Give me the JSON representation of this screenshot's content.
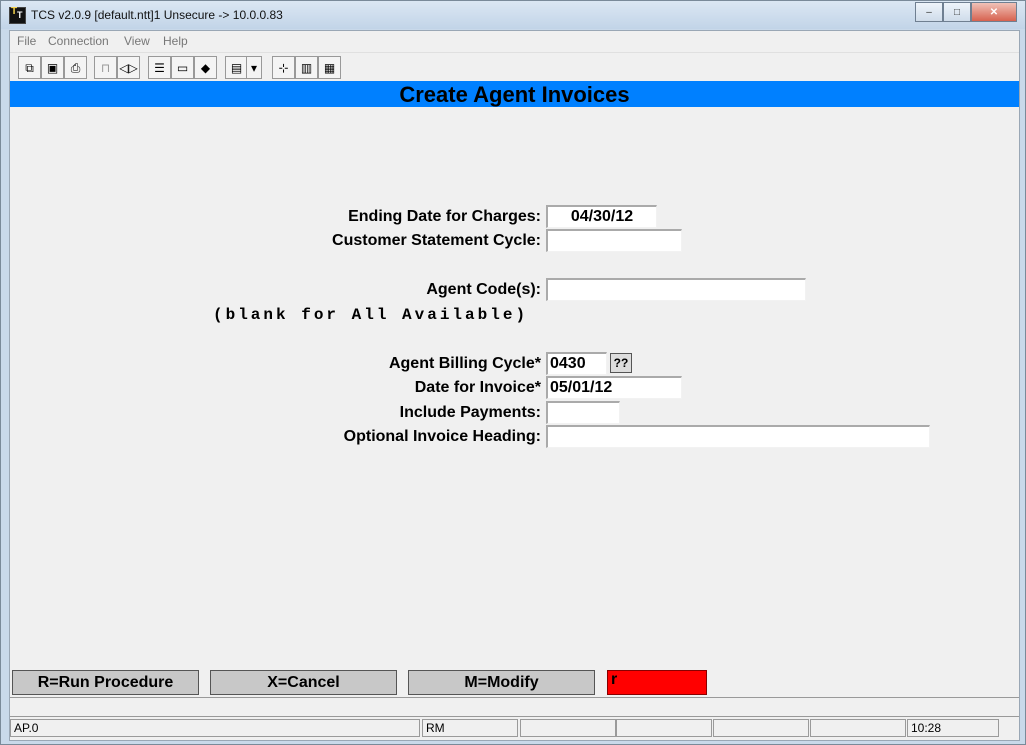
{
  "window": {
    "title": "TCS v2.0.9 [default.ntt]1 Unsecure -> 10.0.0.83",
    "controls": {
      "minimize": "–",
      "maximize": "□",
      "close": "✕"
    }
  },
  "menu": {
    "file": "File",
    "connection": "Connection",
    "view": "View",
    "help": "Help"
  },
  "toolbar": {
    "icons": [
      "copy-icon",
      "save-icon",
      "print-icon",
      "lock-icon",
      "sound-icon",
      "properties-icon",
      "monitor-icon",
      "eraser-icon",
      "document-icon",
      "dropdown-icon",
      "network-icon",
      "chart-icon",
      "calculator-icon"
    ]
  },
  "header": {
    "title": "Create Agent Invoices"
  },
  "form": {
    "ending_date": {
      "label": "Ending Date for Charges:",
      "value": "04/30/12"
    },
    "statement_cycle": {
      "label": "Customer Statement Cycle:",
      "value": ""
    },
    "agent_codes": {
      "label": "Agent Code(s):",
      "value": ""
    },
    "agent_codes_hint": "(blank for All Available)",
    "billing_cycle": {
      "label": "Agent Billing Cycle*",
      "value": "0430",
      "lookup": "??"
    },
    "invoice_date": {
      "label": "Date for Invoice*",
      "value": "05/01/12"
    },
    "include_payments": {
      "label": "Include Payments:",
      "value": ""
    },
    "invoice_heading": {
      "label": "Optional Invoice Heading:",
      "value": ""
    }
  },
  "fkeys": {
    "run": "R=Run Procedure",
    "cancel": "X=Cancel",
    "modify": "M=Modify",
    "input": "r"
  },
  "colors": {
    "header_bg": "#0080ff",
    "input_bg": "#ff0000",
    "form_bg": "#f0f0f0"
  },
  "status": {
    "left": "AP.0",
    "mode": "RM",
    "time": "10:28"
  }
}
